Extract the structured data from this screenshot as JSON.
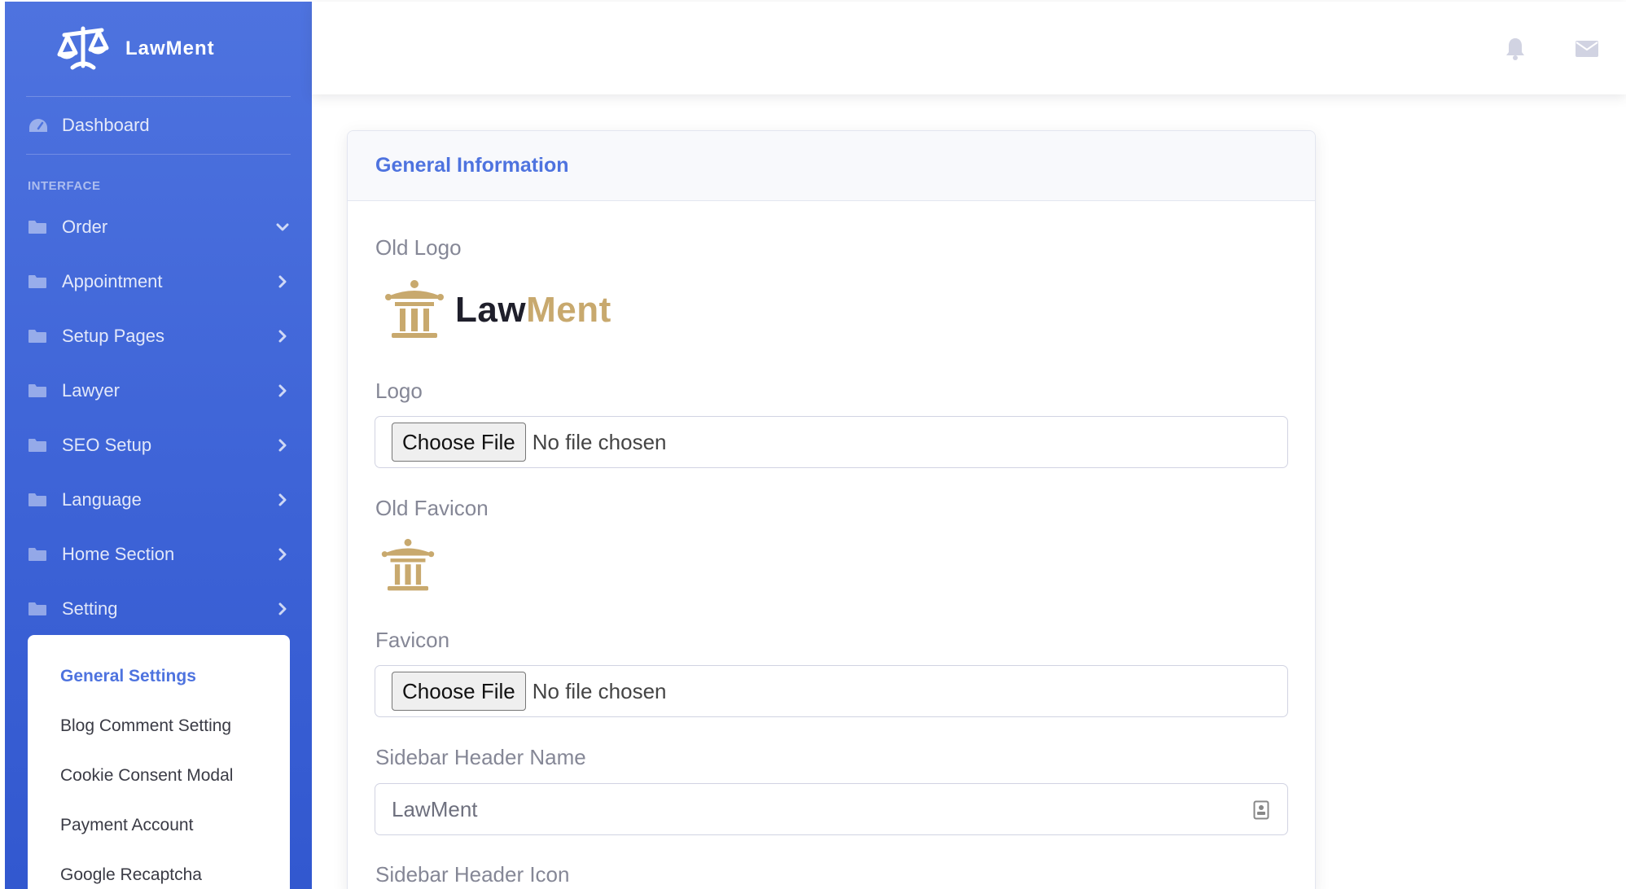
{
  "brand": {
    "name": "LawMent",
    "icon": "scales-icon"
  },
  "sidebar": {
    "dashboard_label": "Dashboard",
    "section_heading": "INTERFACE",
    "items": [
      {
        "label": "Order",
        "icon": "folder-icon",
        "chevron": "down"
      },
      {
        "label": "Appointment",
        "icon": "folder-icon",
        "chevron": "right"
      },
      {
        "label": "Setup Pages",
        "icon": "folder-icon",
        "chevron": "right"
      },
      {
        "label": "Lawyer",
        "icon": "folder-icon",
        "chevron": "right"
      },
      {
        "label": "SEO Setup",
        "icon": "folder-icon",
        "chevron": "right"
      },
      {
        "label": "Language",
        "icon": "folder-icon",
        "chevron": "right"
      },
      {
        "label": "Home Section",
        "icon": "folder-icon",
        "chevron": "right"
      },
      {
        "label": "Setting",
        "icon": "folder-icon",
        "chevron": "right"
      }
    ],
    "submenu": [
      {
        "label": "General Settings",
        "active": true
      },
      {
        "label": "Blog Comment Setting",
        "active": false
      },
      {
        "label": "Cookie Consent Modal",
        "active": false
      },
      {
        "label": "Payment Account",
        "active": false
      },
      {
        "label": "Google Recaptcha",
        "active": false
      }
    ]
  },
  "topbar": {
    "icons": [
      "bell-icon",
      "envelope-icon"
    ]
  },
  "card": {
    "title": "General Information",
    "old_logo_label": "Old Logo",
    "old_logo_text": {
      "part1": "Law",
      "part2": "Ment"
    },
    "logo_label": "Logo",
    "logo_button": "Choose File",
    "logo_status": "No file chosen",
    "old_favicon_label": "Old Favicon",
    "favicon_label": "Favicon",
    "favicon_button": "Choose File",
    "favicon_status": "No file chosen",
    "sidebar_header_name_label": "Sidebar Header Name",
    "sidebar_header_name_value": "LawMent",
    "sidebar_header_icon_label": "Sidebar Header Icon"
  },
  "colors": {
    "primary": "#4e73df",
    "logo_dark": "#1f1f2b",
    "logo_gold": "#c8a96e"
  }
}
